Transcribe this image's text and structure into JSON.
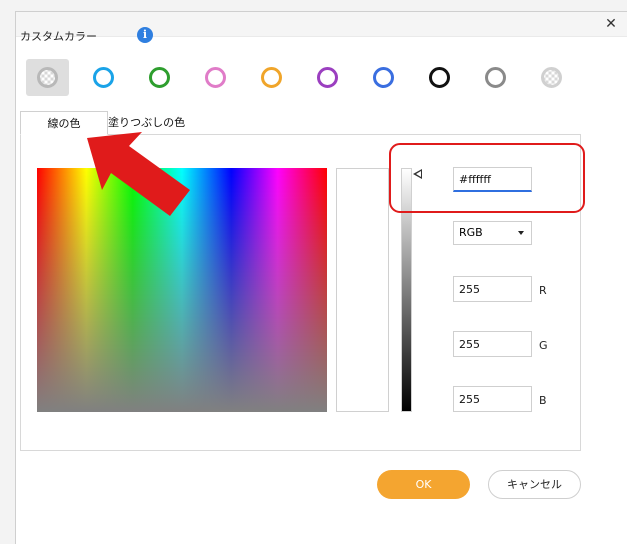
{
  "dialog": {
    "close_glyph": "✕",
    "section_title": "カスタムカラー",
    "info_glyph": "i"
  },
  "swatches": [
    {
      "name": "swatch-transparent-selected",
      "ring_color": "#b8b8b8",
      "checker": true,
      "selected": true
    },
    {
      "name": "swatch-cyan",
      "ring_color": "#1aa3e8",
      "checker": false
    },
    {
      "name": "swatch-green",
      "ring_color": "#2e9e2e",
      "checker": false
    },
    {
      "name": "swatch-pink",
      "ring_color": "#e07cc8",
      "checker": false
    },
    {
      "name": "swatch-orange",
      "ring_color": "#f0a52a",
      "checker": false
    },
    {
      "name": "swatch-purple",
      "ring_color": "#9b3fc0",
      "checker": false
    },
    {
      "name": "swatch-blue",
      "ring_color": "#3a6ee0",
      "checker": false
    },
    {
      "name": "swatch-black",
      "ring_color": "#111111",
      "checker": false
    },
    {
      "name": "swatch-gray",
      "ring_color": "#8a8a8a",
      "checker": false
    },
    {
      "name": "swatch-transparent",
      "ring_color": "#d0d0d0",
      "checker": true
    }
  ],
  "tabs": {
    "line_color": "線の色",
    "fill_color": "塗りつぶしの色"
  },
  "picker": {
    "hex_value": "#ffffff",
    "mode": "RGB",
    "r_value": "255",
    "g_value": "255",
    "b_value": "255",
    "r_label": "R",
    "g_label": "G",
    "b_label": "B",
    "brightness": 1.0
  },
  "buttons": {
    "ok": "OK",
    "cancel": "キャンセル"
  },
  "colors": {
    "accent_orange": "#f4a530",
    "annotation_red": "#e01b1b",
    "input_focus_blue": "#2f6fe0"
  }
}
